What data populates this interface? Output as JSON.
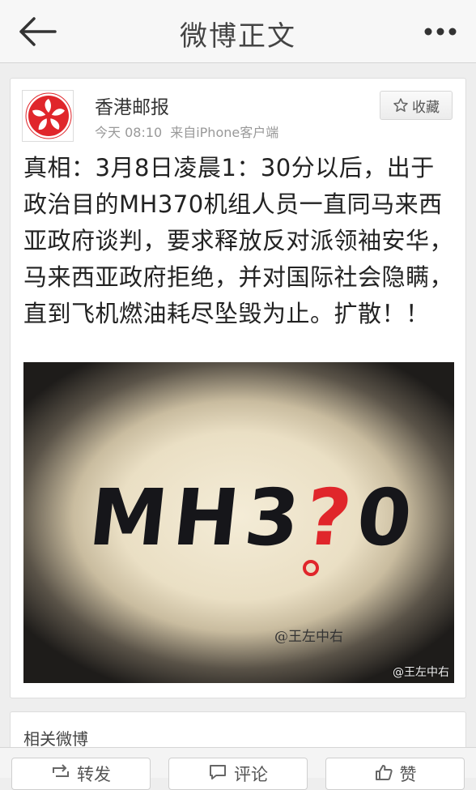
{
  "nav": {
    "title": "微博正文",
    "back_icon": "back-arrow-icon",
    "more_icon": "more-dots-icon"
  },
  "post": {
    "author": "香港邮报",
    "time": "今天 08:10",
    "source": "来自iPhone客户端",
    "favorite_label": "收藏",
    "text": "真相：3月8日凌晨1：30分以后，出于政治目的MH370机组人员一直同马来西亚政府谈判，要求释放反对派领袖安华，马来西亚政府拒绝，并对国际社会隐瞒，直到飞机燃油耗尽坠毁为止。扩散！！",
    "image": {
      "main_text": "MH3?0",
      "signature": "@王左中右",
      "watermark": "@王左中右"
    }
  },
  "related": {
    "title": "相关微博"
  },
  "actions": {
    "repost": "转发",
    "comment": "评论",
    "like": "赞"
  },
  "colors": {
    "accent_red": "#e0262b",
    "navbar_bg": "#f7f7f7",
    "page_bg": "#eeeeee"
  }
}
